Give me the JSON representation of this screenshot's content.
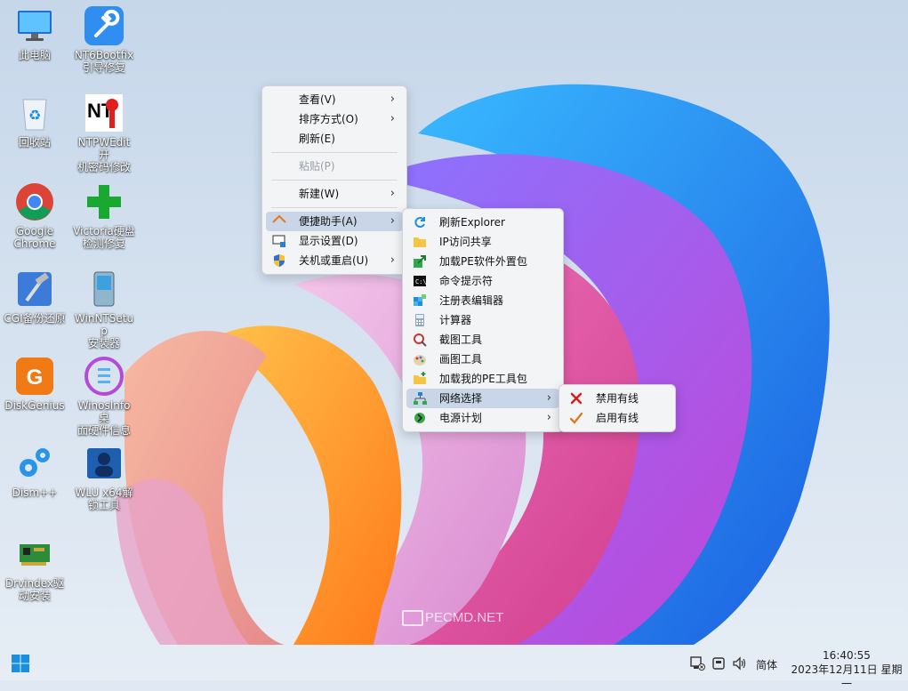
{
  "desktop_icons": [
    {
      "label": "此电脑",
      "icon": "computer-icon"
    },
    {
      "label": "NT6Bootfix\n引导修复",
      "icon": "wrench-icon"
    },
    {
      "label": "回收站",
      "icon": "recycle-bin-icon"
    },
    {
      "label": "NTPWEdit开\n机密码修改",
      "icon": "key-icon"
    },
    {
      "label": "Google\nChrome",
      "icon": "chrome-icon"
    },
    {
      "label": "Victoria硬盘\n检测修复",
      "icon": "green-cross-icon"
    },
    {
      "label": "CGI备份还原",
      "icon": "hammer-icon"
    },
    {
      "label": "WinNTSetup\n安装器",
      "icon": "setup-icon"
    },
    {
      "label": "DiskGenius",
      "icon": "diskgenius-icon"
    },
    {
      "label": "WinosInfo桌\n面硬件信息",
      "icon": "winosinfo-icon"
    },
    {
      "label": "Dism++",
      "icon": "gears-icon"
    },
    {
      "label": "WLU x64解\n锁工具",
      "icon": "users-icon"
    },
    {
      "label": "Drvindex驱\n动安装",
      "icon": "network-card-icon"
    }
  ],
  "menu_main": {
    "items": [
      {
        "label": "查看(V)",
        "submenu": true
      },
      {
        "label": "排序方式(O)",
        "submenu": true
      },
      {
        "label": "刷新(E)",
        "submenu": false
      },
      {
        "label": "粘贴(P)",
        "submenu": false,
        "disabled": true
      },
      {
        "label": "新建(W)",
        "submenu": true
      },
      {
        "label": "便捷助手(A)",
        "submenu": true,
        "highlighted": true,
        "icon": "house-icon"
      },
      {
        "label": "显示设置(D)",
        "submenu": false,
        "icon": "display-settings-icon"
      },
      {
        "label": "关机或重启(U)",
        "submenu": true,
        "icon": "shield-icon"
      }
    ]
  },
  "menu_helper": {
    "items": [
      {
        "label": "刷新Explorer",
        "icon": "refresh-icon"
      },
      {
        "label": "IP访问共享",
        "icon": "folder-icon"
      },
      {
        "label": "加载PE软件外置包",
        "icon": "export-icon"
      },
      {
        "label": "命令提示符",
        "icon": "cmd-icon"
      },
      {
        "label": "注册表编辑器",
        "icon": "registry-icon"
      },
      {
        "label": "计算器",
        "icon": "calculator-icon"
      },
      {
        "label": "截图工具",
        "icon": "snipping-icon"
      },
      {
        "label": "画图工具",
        "icon": "paint-icon"
      },
      {
        "label": "加载我的PE工具包",
        "icon": "folder-add-icon"
      },
      {
        "label": "网络选择",
        "icon": "network-icon",
        "submenu": true,
        "highlighted": true
      },
      {
        "label": "电源计划",
        "icon": "power-plan-icon",
        "submenu": true
      }
    ]
  },
  "menu_network": {
    "items": [
      {
        "label": "禁用有线",
        "icon": "red-x-icon"
      },
      {
        "label": "启用有线",
        "icon": "check-icon"
      }
    ]
  },
  "watermark": "PECMD.NET",
  "taskbar": {
    "ime": "简体",
    "time": "16:40:55",
    "date": "2023年12月11日 星期一"
  }
}
